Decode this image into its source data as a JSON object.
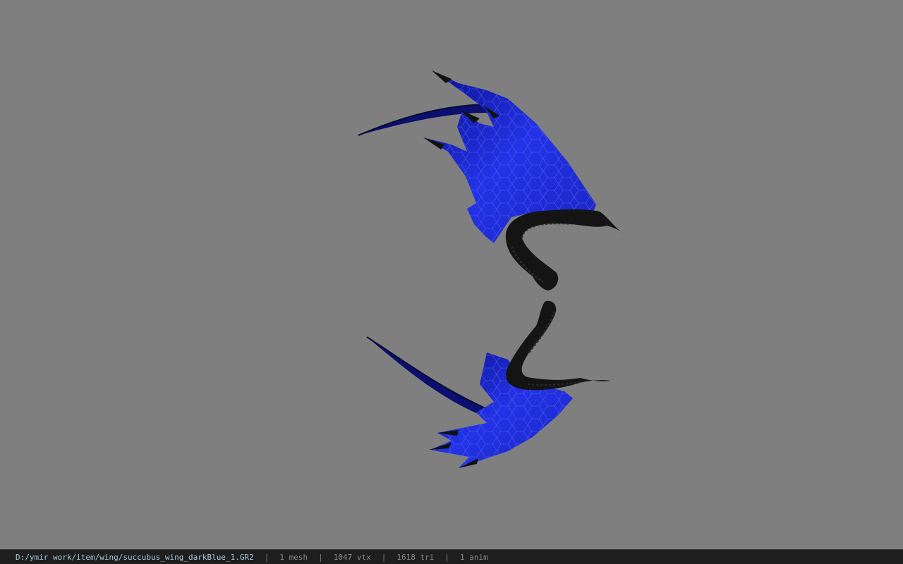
{
  "viewer": {
    "background_color": "#7f7f7f",
    "model": {
      "name": "succubus wing (dark blue)",
      "membrane_color": "#1f2fd9",
      "bone_color": "#111111"
    }
  },
  "status_bar": {
    "file_path": "D:/ymir work/item/wing/succubus_wing_darkBlue_1.GR2",
    "separator": "|",
    "mesh_count": "1 mesh",
    "vertex_count": "1047 vtx",
    "triangle_count": "1618 tri",
    "anim_count": "1 anim"
  }
}
